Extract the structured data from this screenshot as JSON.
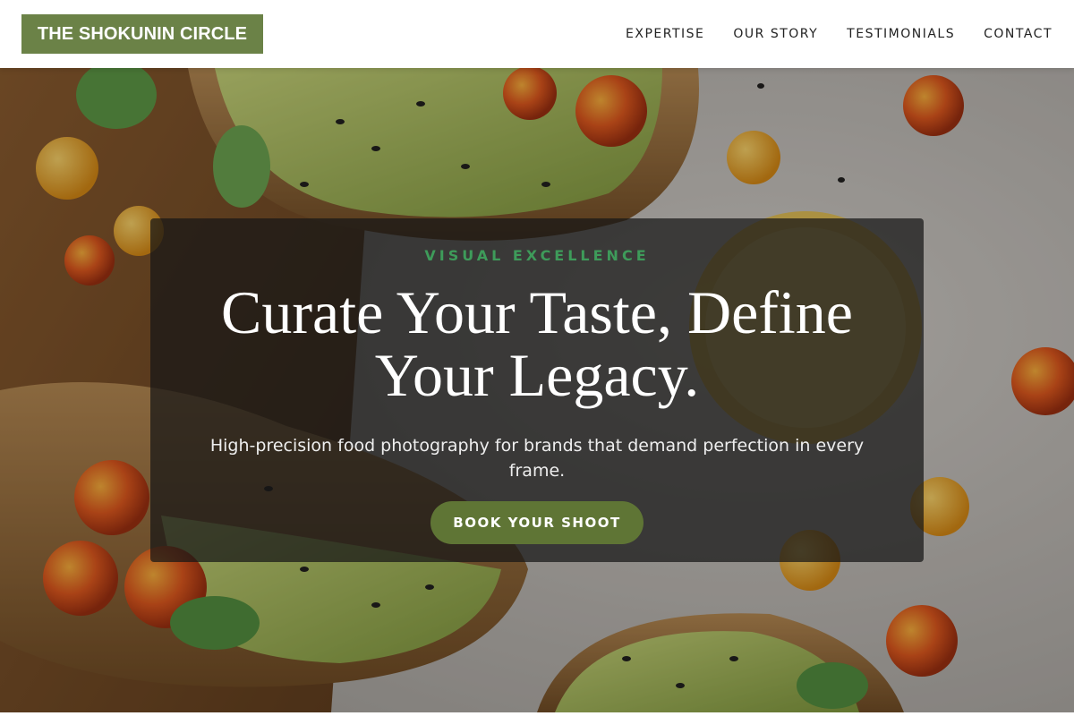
{
  "header": {
    "brand": "THE SHOKUNIN CIRCLE",
    "nav": [
      {
        "label": "EXPERTISE"
      },
      {
        "label": "OUR STORY"
      },
      {
        "label": "TESTIMONIALS"
      },
      {
        "label": "CONTACT"
      }
    ]
  },
  "hero": {
    "image_subject": "avocado toast with cherry tomatoes on wooden board and stone counter",
    "eyebrow": "VISUAL EXCELLENCE",
    "headline": "Curate Your Taste, Define Your Legacy.",
    "subtitle": "High-precision food photography for brands that demand perfection in every frame.",
    "cta_label": "BOOK YOUR SHOOT"
  },
  "colors": {
    "brand_green": "#6b8247",
    "button_green": "#5f7535",
    "eyebrow_green": "#3e9b5a"
  }
}
